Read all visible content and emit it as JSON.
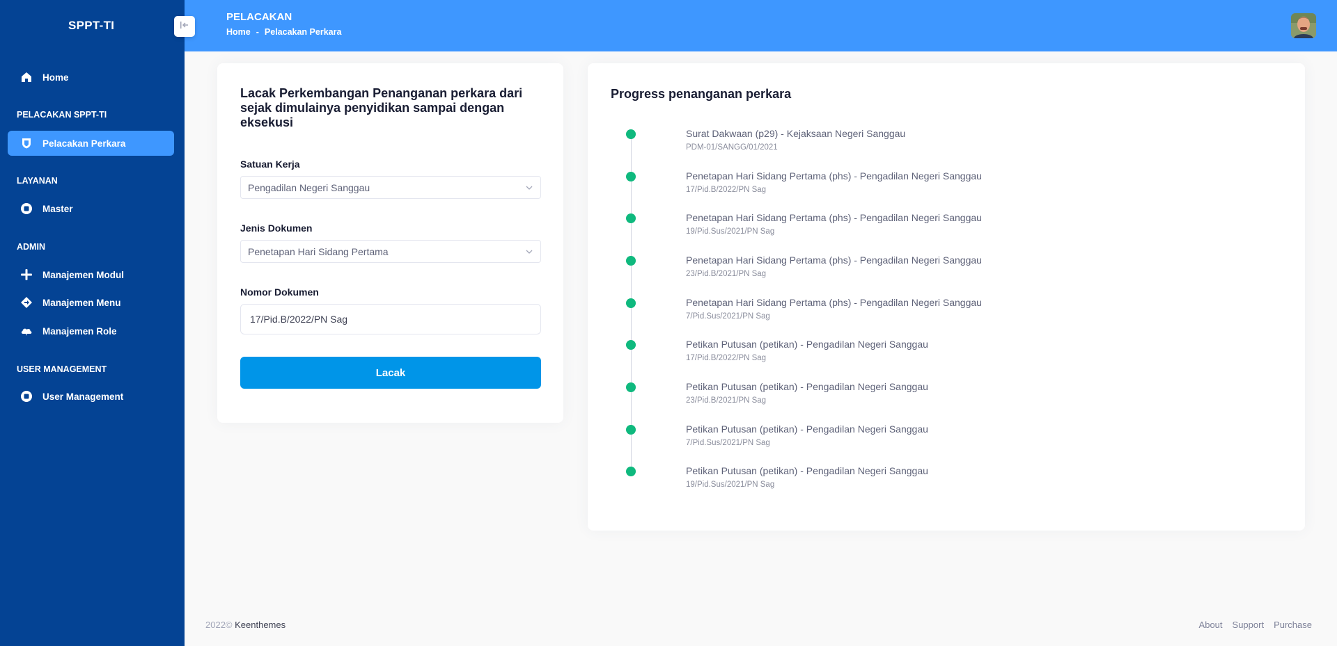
{
  "app": {
    "brand": "SPPT-TI"
  },
  "sidebar": {
    "home": "Home",
    "sections": {
      "pelacakan": "PELACAKAN SPPT-TI",
      "layanan": "LAYANAN",
      "admin": "ADMIN",
      "user_management": "USER MANAGEMENT"
    },
    "items": {
      "pelacakan_perkara": "Pelacakan Perkara",
      "master": "Master",
      "manajemen_modul": "Manajemen Modul",
      "manajemen_menu": "Manajemen Menu",
      "manajemen_role": "Manajemen Role",
      "user_management": "User Management"
    },
    "active_color": "#3e97ff",
    "bg_color": "#044394"
  },
  "header": {
    "title": "PELACAKAN",
    "breadcrumb": [
      "Home",
      "-",
      "Pelacakan Perkara"
    ],
    "bg_color": "#3e97ff"
  },
  "form": {
    "title": "Lacak Perkembangan Penanganan perkara dari sejak dimulainya penyidikan sampai dengan eksekusi",
    "satuan_kerja": {
      "label": "Satuan Kerja",
      "value": "Pengadilan Negeri Sanggau"
    },
    "jenis_dokumen": {
      "label": "Jenis Dokumen",
      "value": "Penetapan Hari Sidang Pertama"
    },
    "nomor_dokumen": {
      "label": "Nomor Dokumen",
      "value": "17/Pid.B/2022/PN Sag"
    },
    "submit_label": "Lacak",
    "submit_color": "#0095e8"
  },
  "progress": {
    "title": "Progress penanganan perkara",
    "dot_color": "#0fb97e",
    "items": [
      {
        "title": "Surat Dakwaan (p29) - Kejaksaan Negeri Sanggau",
        "number": "PDM-01/SANGG/01/2021"
      },
      {
        "title": "Penetapan Hari Sidang Pertama (phs) - Pengadilan Negeri Sanggau",
        "number": "17/Pid.B/2022/PN Sag"
      },
      {
        "title": "Penetapan Hari Sidang Pertama (phs) - Pengadilan Negeri Sanggau",
        "number": "19/Pid.Sus/2021/PN Sag"
      },
      {
        "title": "Penetapan Hari Sidang Pertama (phs) - Pengadilan Negeri Sanggau",
        "number": "23/Pid.B/2021/PN Sag"
      },
      {
        "title": "Penetapan Hari Sidang Pertama (phs) - Pengadilan Negeri Sanggau",
        "number": "7/Pid.Sus/2021/PN Sag"
      },
      {
        "title": "Petikan Putusan (petikan) - Pengadilan Negeri Sanggau",
        "number": "17/Pid.B/2022/PN Sag"
      },
      {
        "title": "Petikan Putusan (petikan) - Pengadilan Negeri Sanggau",
        "number": "23/Pid.B/2021/PN Sag"
      },
      {
        "title": "Petikan Putusan (petikan) - Pengadilan Negeri Sanggau",
        "number": "7/Pid.Sus/2021/PN Sag"
      },
      {
        "title": "Petikan Putusan (petikan) - Pengadilan Negeri Sanggau",
        "number": "19/Pid.Sus/2021/PN Sag"
      }
    ]
  },
  "footer": {
    "year": "2022©",
    "brand": "Keenthemes",
    "links": {
      "about": "About",
      "support": "Support",
      "purchase": "Purchase"
    }
  }
}
